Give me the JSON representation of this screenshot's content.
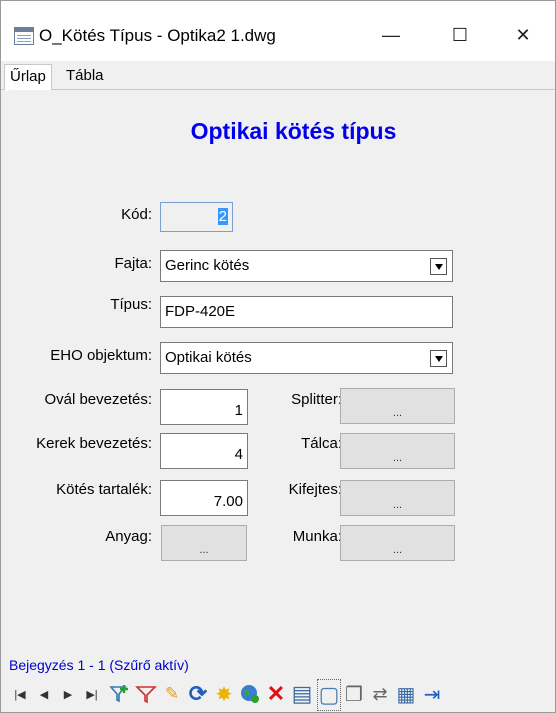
{
  "window": {
    "title": "O_Kötés Típus - Optika2 1.dwg",
    "minimize_glyph": "—",
    "maximize_glyph": "☐",
    "close_glyph": "✕"
  },
  "tabs": [
    {
      "label": "Űrlap",
      "active": true
    },
    {
      "label": "Tábla",
      "active": false
    }
  ],
  "form": {
    "title": "Optikai kötés típus",
    "kod": {
      "label": "Kód:",
      "value": "2"
    },
    "fajta": {
      "label": "Fajta:",
      "value": "Gerinc kötés"
    },
    "tipus": {
      "label": "Típus:",
      "value": "FDP-420E"
    },
    "eho": {
      "label": "EHO objektum:",
      "value": "Optikai kötés"
    },
    "oval": {
      "label": "Ovál bevezetés:",
      "value": "1"
    },
    "kerek": {
      "label": "Kerek bevezetés:",
      "value": "4"
    },
    "tartalek": {
      "label": "Kötés tartalék:",
      "value": "7.00"
    },
    "anyag": {
      "label": "Anyag:",
      "button": "..."
    },
    "splitter": {
      "label": "Splitter:",
      "button": "..."
    },
    "talca": {
      "label": "Tálca:",
      "button": "..."
    },
    "kifejtes": {
      "label": "Kifejtes:",
      "button": "..."
    },
    "munka": {
      "label": "Munka:",
      "button": "..."
    }
  },
  "status": "Bejegyzés 1 - 1 (Szűrő aktív)",
  "toolbar": {
    "first": "|◀",
    "prev": "◀",
    "next": "▶",
    "last": "▶|",
    "filter_add": "+",
    "filter": "▽",
    "edit": "✎",
    "refresh": "⟳",
    "new": "✸",
    "web": "●",
    "delete": "✕",
    "print": "▤",
    "select": "▢",
    "copy": "❐",
    "link": "⇄",
    "table": "▦",
    "exit": "⇥"
  },
  "colors": {
    "title_blue": "#0000ee",
    "status_blue": "#0000cc",
    "filter_green": "#2aa02a",
    "filter_red": "#d03030",
    "refresh_blue": "#1f5fbf",
    "new_yellow": "#f0b000",
    "delete_red": "#e01010",
    "selection_blue": "#3399ff"
  }
}
